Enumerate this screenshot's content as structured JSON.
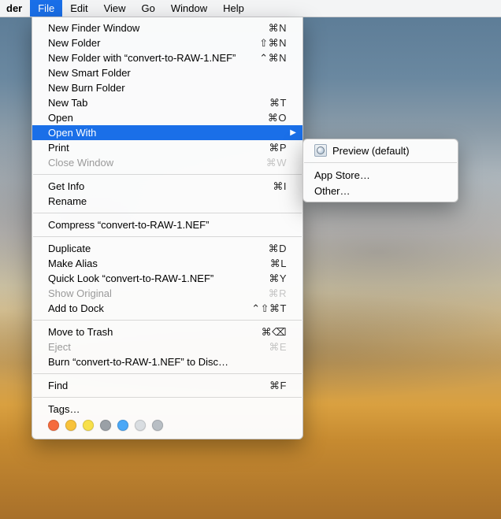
{
  "menubar": {
    "app_fragment": "der",
    "items": [
      "File",
      "Edit",
      "View",
      "Go",
      "Window",
      "Help"
    ],
    "open_index": 0
  },
  "file_menu": {
    "groups": [
      [
        {
          "label": "New Finder Window",
          "shortcut": "⌘N"
        },
        {
          "label": "New Folder",
          "shortcut": "⇧⌘N"
        },
        {
          "label": "New Folder with “convert-to-RAW-1.NEF”",
          "shortcut": "⌃⌘N"
        },
        {
          "label": "New Smart Folder",
          "shortcut": ""
        },
        {
          "label": "New Burn Folder",
          "shortcut": ""
        },
        {
          "label": "New Tab",
          "shortcut": "⌘T"
        },
        {
          "label": "Open",
          "shortcut": "⌘O"
        },
        {
          "label": "Open With",
          "shortcut": "",
          "submenu": true,
          "highlight": true
        },
        {
          "label": "Print",
          "shortcut": "⌘P"
        },
        {
          "label": "Close Window",
          "shortcut": "⌘W",
          "disabled": true
        }
      ],
      [
        {
          "label": "Get Info",
          "shortcut": "⌘I"
        },
        {
          "label": "Rename",
          "shortcut": ""
        }
      ],
      [
        {
          "label": "Compress “convert-to-RAW-1.NEF”",
          "shortcut": ""
        }
      ],
      [
        {
          "label": "Duplicate",
          "shortcut": "⌘D"
        },
        {
          "label": "Make Alias",
          "shortcut": "⌘L"
        },
        {
          "label": "Quick Look “convert-to-RAW-1.NEF”",
          "shortcut": "⌘Y"
        },
        {
          "label": "Show Original",
          "shortcut": "⌘R",
          "disabled": true
        },
        {
          "label": "Add to Dock",
          "shortcut": "⌃⇧⌘T"
        }
      ],
      [
        {
          "label": "Move to Trash",
          "shortcut": "⌘⌫"
        },
        {
          "label": "Eject",
          "shortcut": "⌘E",
          "disabled": true
        },
        {
          "label": "Burn “convert-to-RAW-1.NEF” to Disc…",
          "shortcut": ""
        }
      ],
      [
        {
          "label": "Find",
          "shortcut": "⌘F"
        }
      ],
      [
        {
          "label": "Tags…",
          "shortcut": ""
        }
      ]
    ],
    "tag_colors": [
      "#f56b3d",
      "#f8c23a",
      "#f8e04a",
      "#9aa0a6",
      "#4aa8f7",
      "#d9dde1",
      "#b8bec4"
    ]
  },
  "open_with_submenu": {
    "items": [
      {
        "label": "Preview (default)",
        "icon": true
      },
      {
        "label": "App Store…"
      },
      {
        "label": "Other…"
      }
    ],
    "separator_after": 0
  }
}
